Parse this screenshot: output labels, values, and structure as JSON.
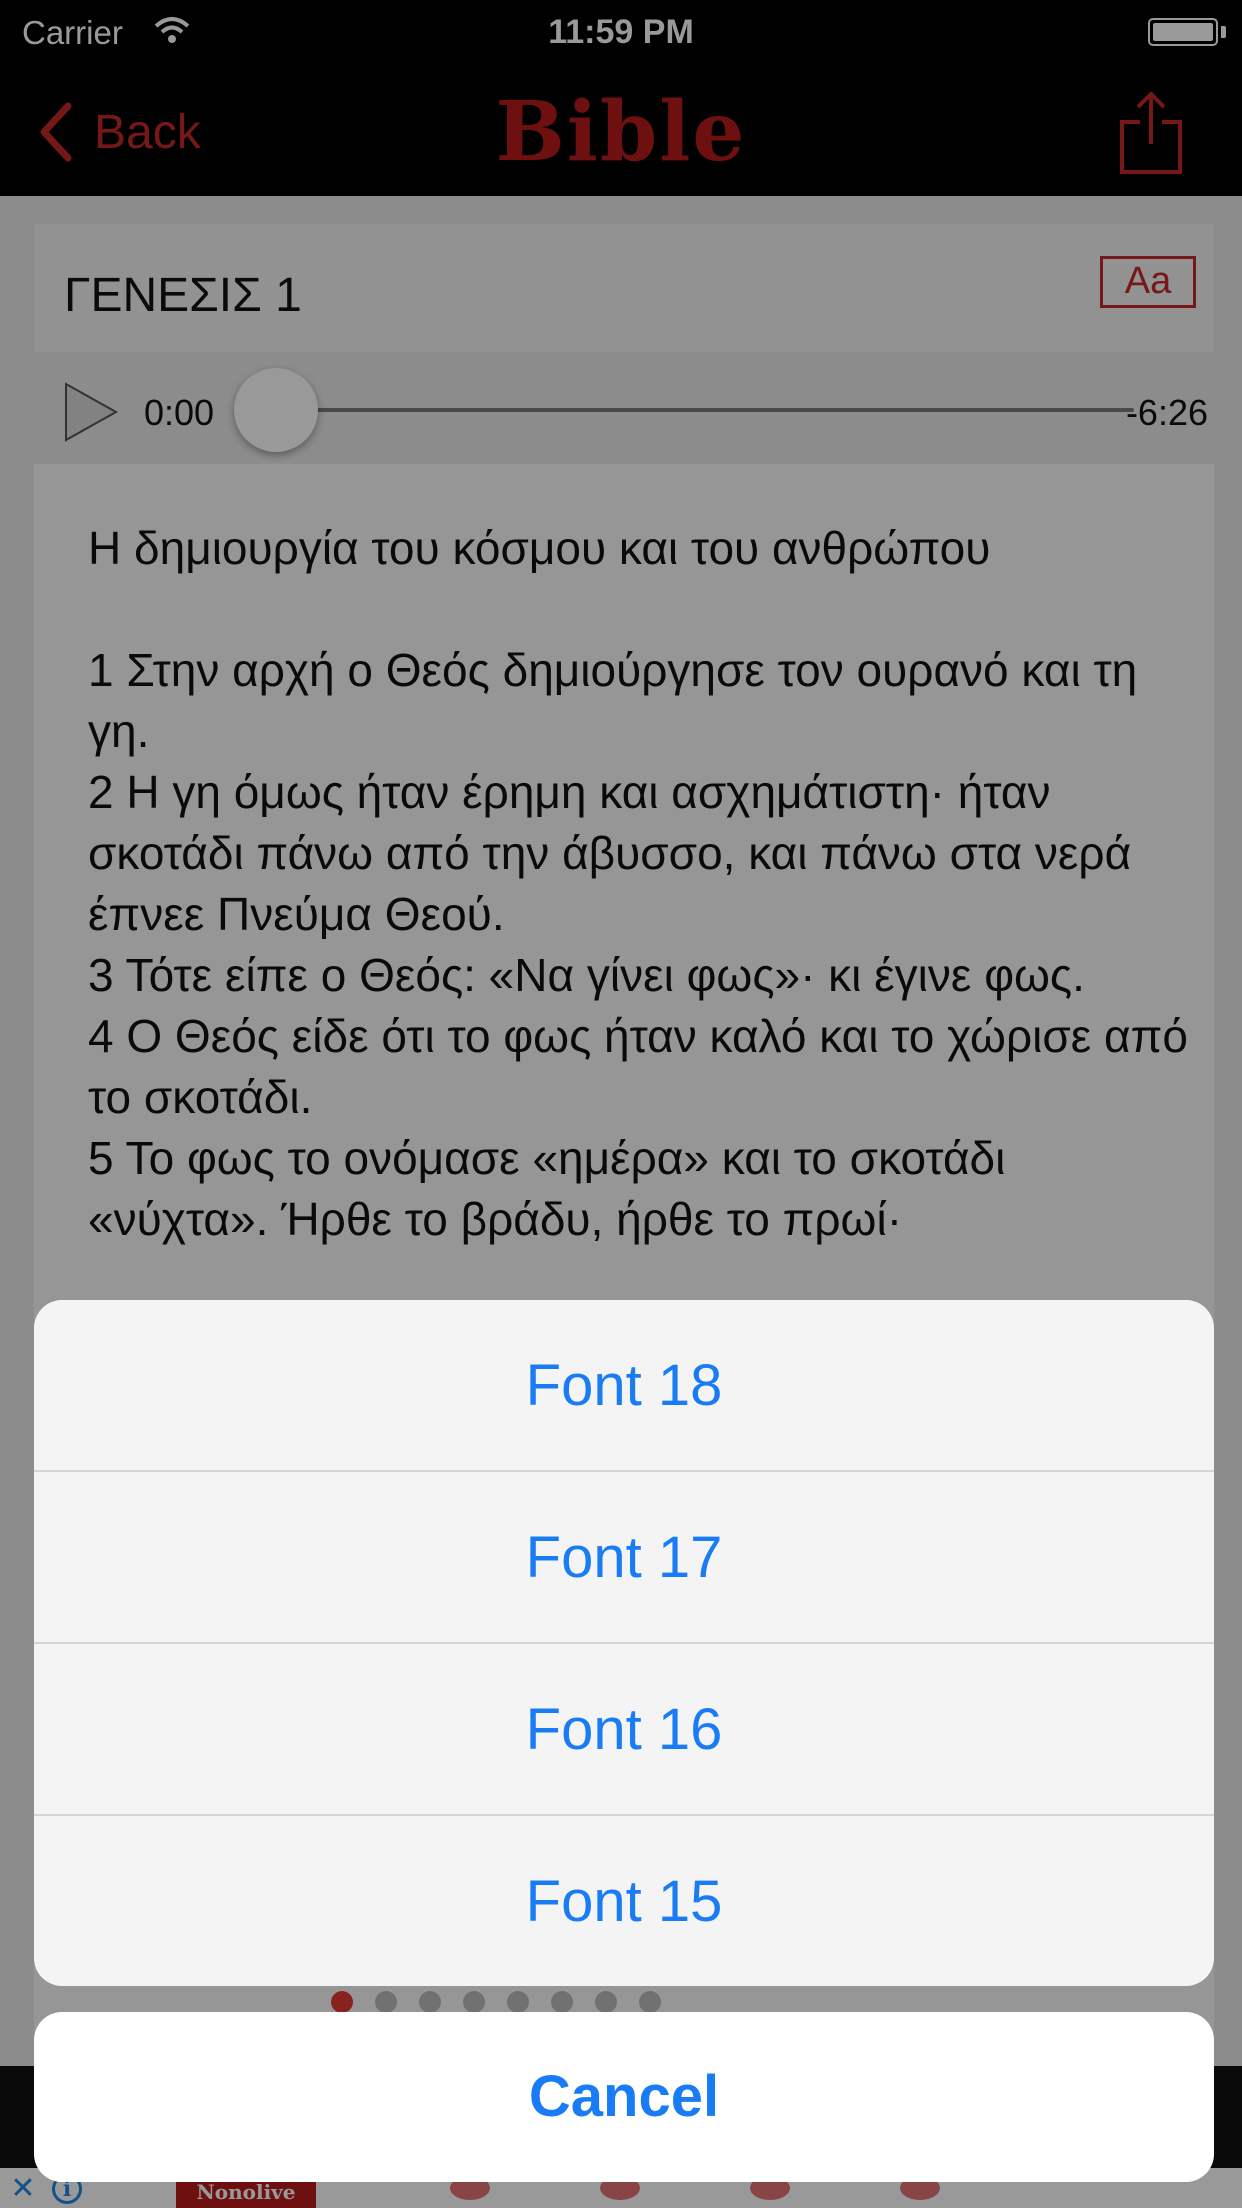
{
  "status_bar": {
    "carrier": "Carrier",
    "time": "11:59 PM"
  },
  "nav": {
    "back_label": "Back",
    "title": "Bible"
  },
  "chapter": {
    "title": "ΓΕΝΕΣΙΣ 1",
    "font_button": "Aa"
  },
  "player": {
    "current_time": "0:00",
    "remaining_time": "-6:26",
    "progress": 0
  },
  "passage": {
    "heading": "Η δημιουργία του κόσμου και του ανθρώπου",
    "verses": [
      "1 Στην αρχή ο Θεός δημιούργησε τον ουρανό και τη γη.",
      "2 Η γη όμως ήταν έρημη και ασχημάτιστη· ήταν σκοτάδι πάνω από την άβυσσο, και πάνω στα νερά έπνεε Πνεύμα Θεού.",
      "3 Τότε είπε ο Θεός: «Να γίνει φως»· κι έγινε φως.",
      "4 Ο Θεός είδε ότι το φως ήταν καλό και το χώρισε από το σκοτάδι.",
      "5 Το φως το ονόμασε «ημέρα» και το σκοτάδι «νύχτα». Ήρθε το βράδυ, ήρθε το πρωί·"
    ]
  },
  "pager": {
    "count": 8,
    "active_index": 0
  },
  "ad": {
    "brand": "Nonolive"
  },
  "action_sheet": {
    "options": [
      "Font 18",
      "Font 17",
      "Font 16",
      "Font 15"
    ],
    "cancel": "Cancel"
  },
  "colors": {
    "accent_red": "#c62828",
    "ios_blue": "#1a7cf5"
  }
}
